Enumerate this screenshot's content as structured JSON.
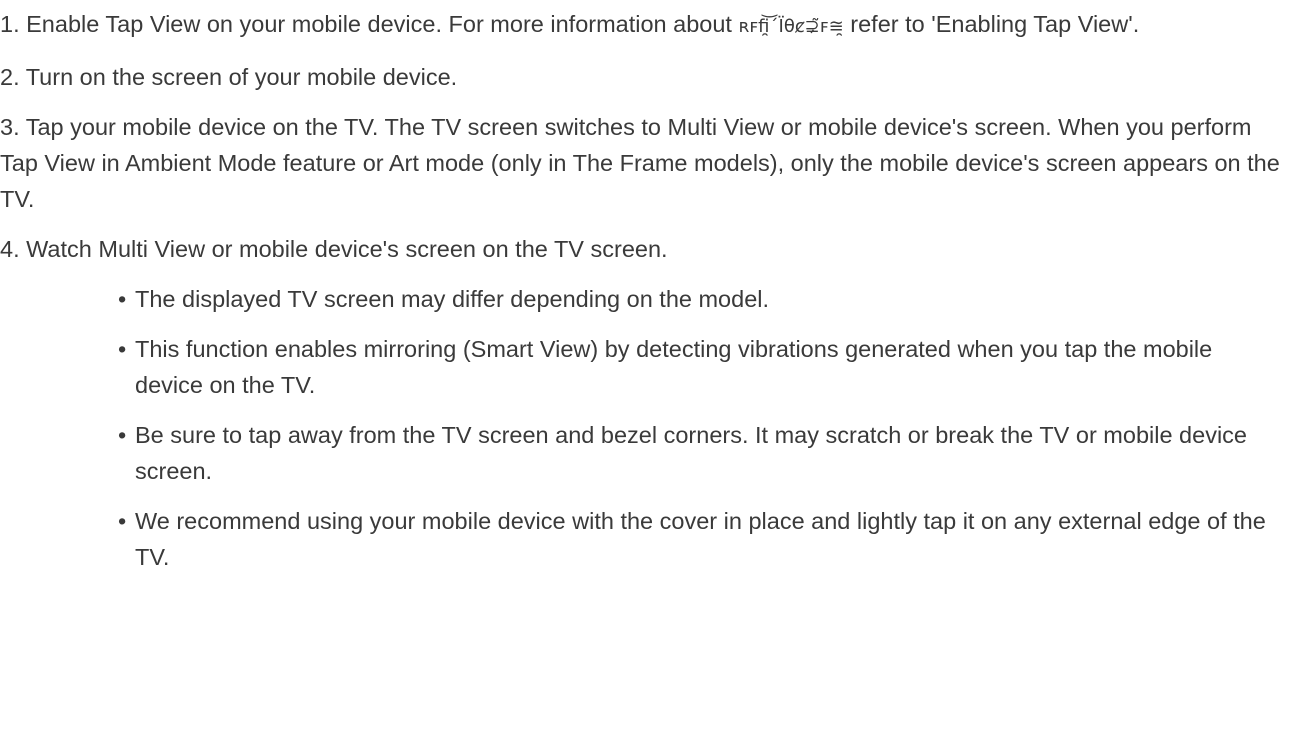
{
  "steps": [
    {
      "prefix": "1. Enable Tap View on your mobile device. For more information about ",
      "garbled": "ʀꜰfi̯͝ˊÏθȼ⊋̃ꜰ≅̯",
      "suffix": " refer to 'Enabling Tap View'."
    },
    {
      "text": "2. Turn on the screen of your mobile device."
    },
    {
      "text": "3. Tap your mobile device on the TV. The TV screen switches to Multi View or mobile device's screen. When you perform Tap View in Ambient Mode feature or Art mode (only in The Frame models), only the mobile device's screen appears on the TV."
    },
    {
      "text": "4. Watch Multi View or mobile device's screen on the TV screen."
    }
  ],
  "bullet_symbol": "•",
  "notes": [
    "The displayed TV screen may differ depending on the model.",
    "This function enables mirroring (Smart View) by detecting vibrations generated when you tap the mobile device on the TV.",
    "Be sure to tap away from the TV screen and bezel corners. It may scratch or break the TV or mobile device screen.",
    "We recommend using your mobile device with the cover in place and lightly tap it on any external edge of the TV."
  ]
}
